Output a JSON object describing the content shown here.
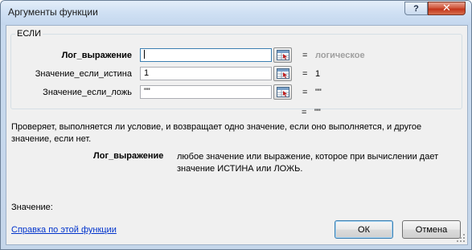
{
  "window": {
    "title": "Аргументы функции",
    "help_button": "?",
    "close_button": "✕"
  },
  "function": {
    "name": "ЕСЛИ",
    "arguments": [
      {
        "label": "Лог_выражение",
        "value": "",
        "result": "логическое"
      },
      {
        "label": "Значение_если_истина",
        "value": "1",
        "result": "1"
      },
      {
        "label": "Значение_если_ложь",
        "value": "\"\"",
        "result": "\"\""
      }
    ],
    "equals": "=",
    "formula_result": "\"\""
  },
  "description": {
    "text": "Проверяет, выполняется ли условие, и возвращает одно значение, если оно выполняется, и другое значение, если нет.",
    "arg_label": "Лог_выражение",
    "arg_text": "любое значение или выражение, которое при вычислении дает значение ИСТИНА или ЛОЖЬ."
  },
  "footer": {
    "value_label": "Значение:",
    "help_link": "Справка по этой функции",
    "ok_label": "ОК",
    "cancel_label": "Отмена"
  },
  "colors": {
    "link": "#0033cc",
    "hint_result": "#a0a0a0",
    "close_button": "#c3351b"
  }
}
